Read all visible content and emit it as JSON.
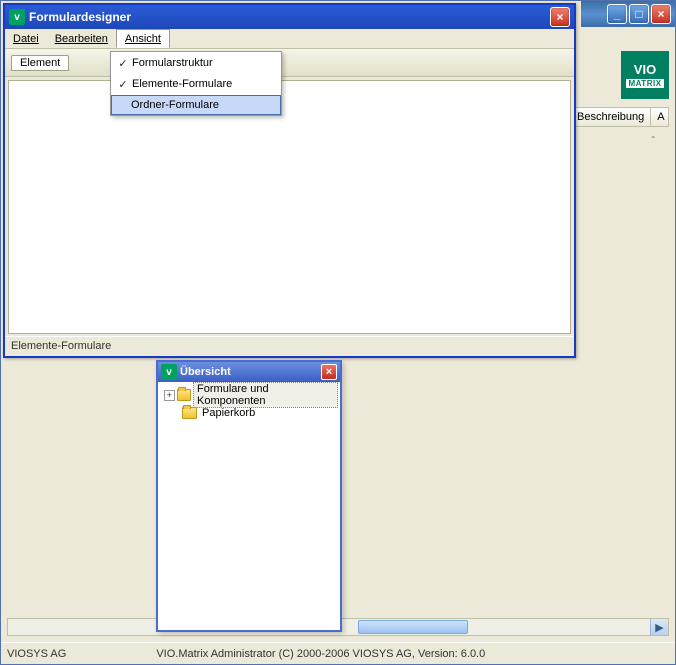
{
  "main_window": {
    "titlebar_buttons": {
      "min": "_",
      "max": "□",
      "close": "×"
    }
  },
  "logo": {
    "top": "VIO",
    "bottom": "MATRIX"
  },
  "columns": {
    "beschreibung": "Beschreibung",
    "a": "A"
  },
  "dash": "-",
  "statusbar": {
    "company": "VIOSYS AG",
    "copyright": "VIO.Matrix Administrator (C) 2000-2006 VIOSYS AG, Version: 6.0.0"
  },
  "fd_window": {
    "title": "Formulardesigner",
    "menu": {
      "file": "Datei",
      "edit": "Bearbeiten",
      "view": "Ansicht"
    },
    "tab": "Element",
    "dropdown": {
      "item1": "Formularstruktur",
      "item2": "Elemente-Formulare",
      "item3": "Ordner-Formulare"
    },
    "status": "Elemente-Formulare",
    "close": "×"
  },
  "ov_window": {
    "title": "Übersicht",
    "close": "×",
    "tree": {
      "root": "Formulare und Komponenten",
      "trash": "Papierkorb"
    }
  }
}
